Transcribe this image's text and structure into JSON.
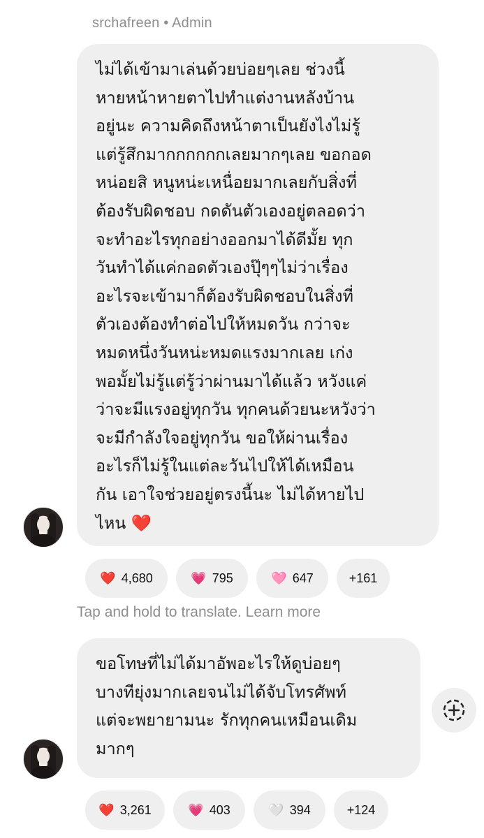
{
  "sender": {
    "username": "srchafreen",
    "separator": "•",
    "role": "Admin"
  },
  "messages": [
    {
      "lines": [
        "ไม่ได้เข้ามาเล่นด้วยบ่อยๆเลย ช่วงนี้",
        "หายหน้าหายตาไปทำแต่งานหลังบ้าน",
        "อยู่นะ ความคิดถึงหน้าตาเป็นยังไงไม่รู้",
        "แต่รู้สึกมากกกกกกเลยมากๆเลย ขอกอด",
        "หน่อยสิ หนูหน่ะเหนื่อยมากเลยกับสิ่งที่",
        "ต้องรับผิดชอบ กดดันตัวเองอยู่ตลอดว่า",
        "จะทำอะไรทุกอย่างออกมาได้ดีมั้ย ทุก",
        "วันทำได้แค่กอดตัวเองปุ๊ๆๆไม่ว่าเรื่อง",
        "อะไรจะเข้ามาก็ต้องรับผิดชอบในสิ่งที่",
        "ตัวเองต้องทำต่อไปให้หมดวัน กว่าจะ",
        "หมดหนึ่งวันหน่ะหมดแรงมากเลย เก่ง",
        "พอมั้ยไม่รู้แต่รู้ว่าผ่านมาได้แล้ว หวังแค่",
        "ว่าจะมีแรงอยู่ทุกวัน ทุกคนด้วยนะหวังว่า",
        "จะมีกำลังใจอยู่ทุกวัน ขอให้ผ่านเรื่อง",
        "อะไรก็ไม่รู้ในแต่ละวันไปให้ได้เหมือน",
        "กัน เอาใจช่วยอยู่ตรงนี้นะ ไม่ได้หายไป",
        "ไหน"
      ],
      "trailing_emoji": "❤️",
      "reactions": [
        {
          "emoji": "❤️",
          "count": "4,680"
        },
        {
          "emoji": "💗",
          "count": "795"
        },
        {
          "emoji": "🩷",
          "count": "647"
        },
        {
          "emoji": "",
          "count": "+161"
        }
      ]
    },
    {
      "lines": [
        "ขอโทษที่ไม่ได้มาอัพอะไรให้ดูบ่อยๆ",
        "บางทียุ่งมากเลยจนไม่ได้จับโทรศัพท์",
        "แต่จะพยายามนะ รักทุกคนเหมือนเดิม",
        "มากๆ"
      ],
      "reactions": [
        {
          "emoji": "❤️",
          "count": "3,261"
        },
        {
          "emoji": "💗",
          "count": "403"
        },
        {
          "emoji": "🤍",
          "count": "394"
        },
        {
          "emoji": "",
          "count": "+124"
        }
      ]
    }
  ],
  "translate_hint": "Tap and hold to translate. Learn more",
  "icons": {
    "avatar": "avatar",
    "add_reaction": "add-reaction-icon"
  },
  "colors": {
    "bubble": "#efefef",
    "muted_text": "#8e8e8e",
    "heart": "#e0202e"
  }
}
